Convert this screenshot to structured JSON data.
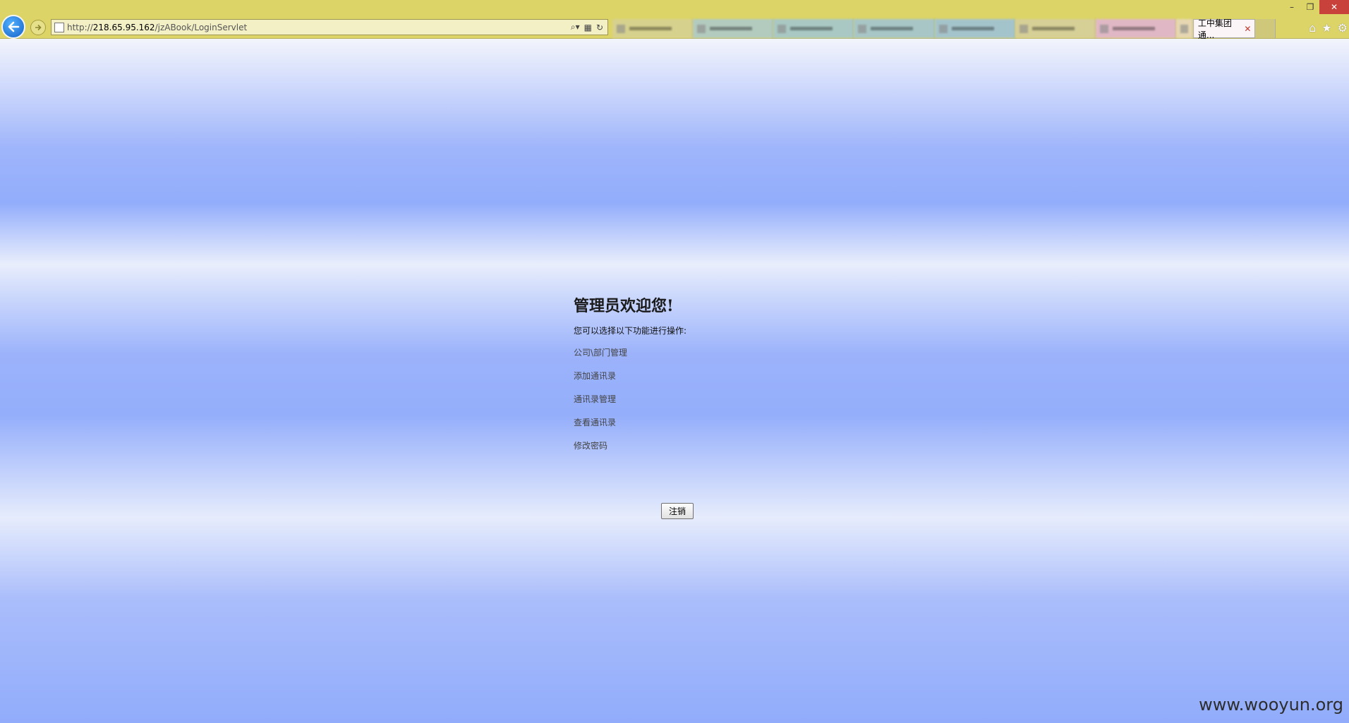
{
  "browser": {
    "url_prefix": "http://",
    "url_host": "218.65.95.162",
    "url_path": "/jzABook/LoginServlet",
    "active_tab_title": "工中集团通...",
    "window_controls": {
      "minimize": "–",
      "restore": "❐",
      "close": "✕"
    },
    "colors": {
      "chrome": "#dcd466",
      "close": "#c8413a",
      "back": "#1560c6"
    }
  },
  "page": {
    "title": "管理员欢迎您!",
    "subtitle": "您可以选择以下功能进行操作:",
    "menu": [
      {
        "label": "公司\\部门管理"
      },
      {
        "label": "添加通讯录"
      },
      {
        "label": "通讯录管理"
      },
      {
        "label": "查看通讯录"
      },
      {
        "label": "修改密码"
      }
    ],
    "logout_label": "注销"
  },
  "watermark": "www.wooyun.org"
}
